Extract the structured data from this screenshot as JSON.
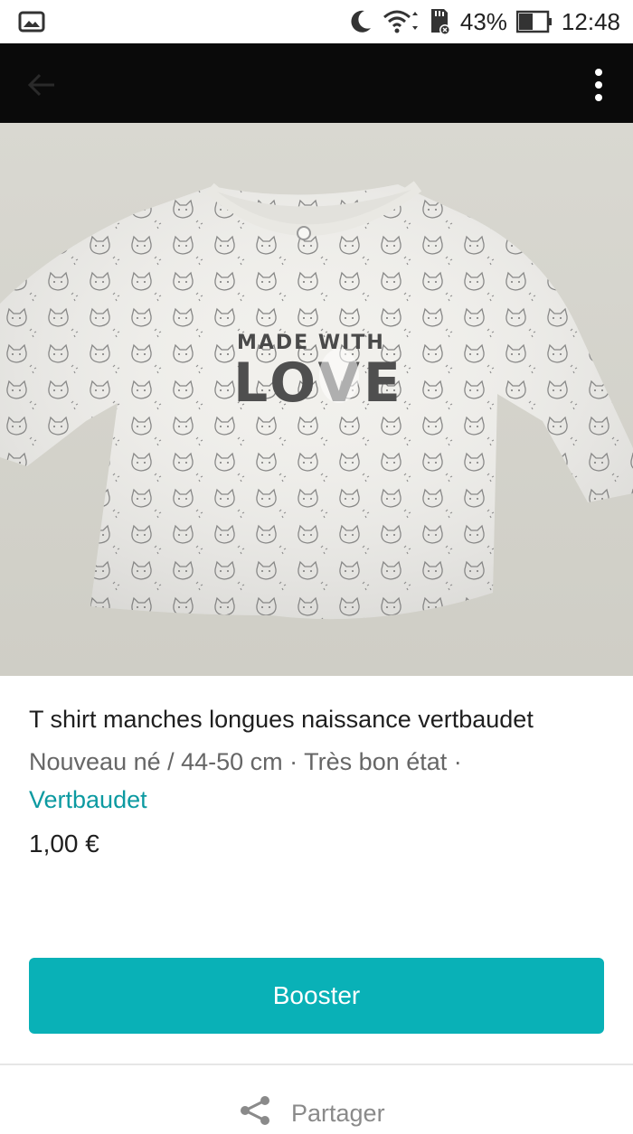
{
  "status_bar": {
    "battery_percent": "43%",
    "time": "12:48"
  },
  "listing": {
    "title": "T shirt manches longues naissance vertbaudet",
    "size_condition": "Nouveau né / 44-50 cm · Très bon état ·",
    "brand": "Vertbaudet",
    "price": "1,00 €"
  },
  "photo_print_text": "MADE WITH LOVE",
  "actions": {
    "booster_label": "Booster",
    "share_label": "Partager"
  },
  "colors": {
    "accent": "#09b1b7",
    "brand_link": "#0c9aa1",
    "appbar": "#0a0a0a"
  },
  "icons": [
    "gallery-icon",
    "moon-icon",
    "wifi-icon",
    "sd-card-icon",
    "battery-icon",
    "back-arrow-icon",
    "more-vert-icon",
    "share-icon"
  ]
}
